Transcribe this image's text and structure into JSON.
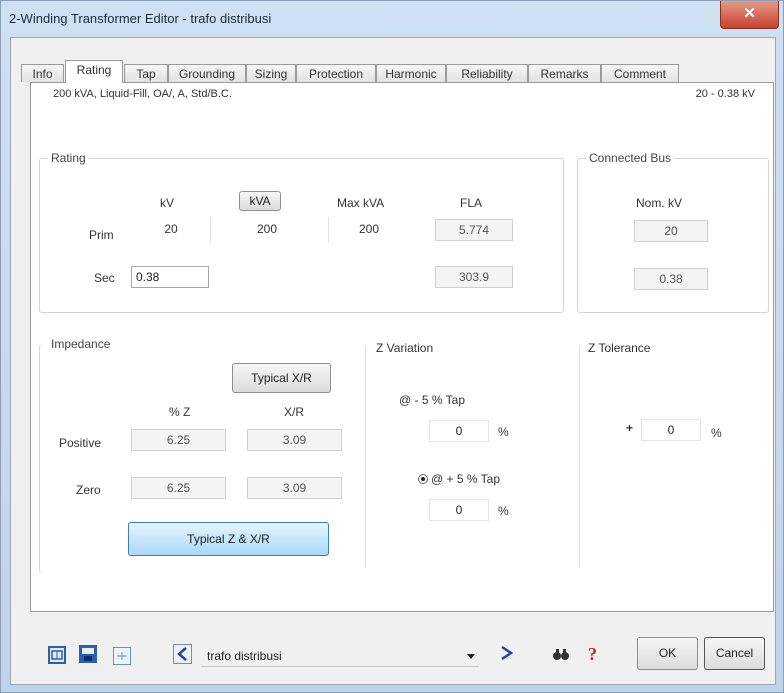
{
  "window": {
    "title": "2-Winding Transformer Editor - trafo distribusi",
    "close_glyph": "✕"
  },
  "tabs": [
    {
      "label": "Info"
    },
    {
      "label": "Rating"
    },
    {
      "label": "Tap"
    },
    {
      "label": "Grounding"
    },
    {
      "label": "Sizing"
    },
    {
      "label": "Protection"
    },
    {
      "label": "Harmonic"
    },
    {
      "label": "Reliability"
    },
    {
      "label": "Remarks"
    },
    {
      "label": "Comment"
    }
  ],
  "info": {
    "left": "200 kVA, Liquid-Fill, OA/, A, Std/B.C.",
    "right": "20 - 0.38 kV"
  },
  "rating": {
    "legend": "Rating",
    "col_kv": "kV",
    "col_kva": "kVA",
    "col_max_kva": "Max kVA",
    "col_fla": "FLA",
    "prim_label": "Prim",
    "prim_kv": "20",
    "prim_kva": "200",
    "prim_max_kva": "200",
    "prim_fla": "5.774",
    "sec_label": "Sec",
    "sec_kv": "0.38",
    "sec_fla": "303.9"
  },
  "connected_bus": {
    "legend": "Connected Bus",
    "col_nom_kv": "Nom. kV",
    "prim_nom_kv": "20",
    "sec_nom_kv": "0.38"
  },
  "impedance": {
    "legend": "Impedance",
    "typical_xr_button": "Typical X/R",
    "col_z": "% Z",
    "col_xr": "X/R",
    "positive_label": "Positive",
    "positive_z": "6.25",
    "positive_xr": "3.09",
    "zero_label": "Zero",
    "zero_z": "6.25",
    "zero_xr": "3.09",
    "typical_z_xr_button": "Typical Z & X/R"
  },
  "z_variation": {
    "legend": "Z Variation",
    "neg_tap_label": "@ - 5 % Tap",
    "neg_tap_value": "0",
    "neg_unit": "%",
    "pos_tap_label": "@ + 5 % Tap",
    "pos_tap_value": "0",
    "pos_unit": "%"
  },
  "z_tolerance": {
    "legend": "Z Tolerance",
    "sign": "+",
    "value": "0",
    "unit": "%"
  },
  "bottom": {
    "selector_value": "trafo distribusi",
    "ok_label": "OK",
    "cancel_label": "Cancel"
  }
}
